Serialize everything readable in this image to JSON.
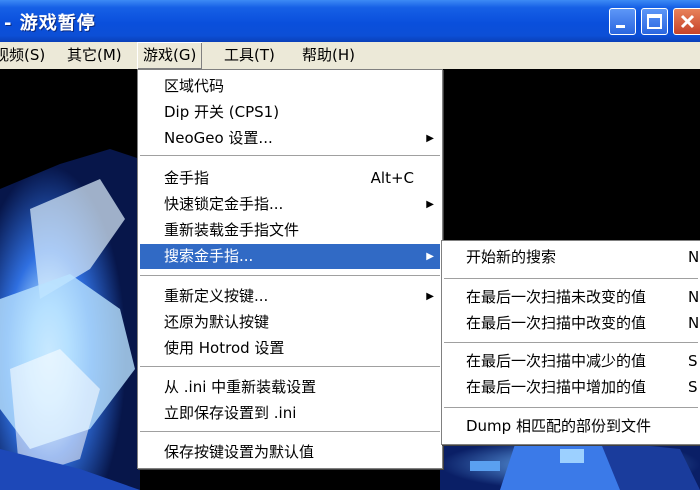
{
  "window": {
    "title": "- 游戏暂停"
  },
  "menubar": [
    {
      "label": "视频(S)"
    },
    {
      "label": "其它(M)"
    },
    {
      "label": "游戏(G)"
    },
    {
      "label": "工具(T)"
    },
    {
      "label": "帮助(H)"
    }
  ],
  "game_menu": {
    "items": [
      {
        "label": "区域代码"
      },
      {
        "label": "Dip 开关 (CPS1)"
      },
      {
        "label": "NeoGeo 设置...",
        "submenu": true
      },
      {
        "label": "金手指",
        "shortcut": "Alt+C"
      },
      {
        "label": "快速锁定金手指...",
        "submenu": true
      },
      {
        "label": "重新装载金手指文件"
      },
      {
        "label": "搜索金手指...",
        "submenu": true,
        "highlighted": true
      },
      {
        "label": "重新定义按键...",
        "submenu": true
      },
      {
        "label": "还原为默认按键"
      },
      {
        "label": "使用 Hotrod 设置"
      },
      {
        "label": "从 .ini 中重新装载设置"
      },
      {
        "label": "立即保存设置到 .ini"
      },
      {
        "label": "保存按键设置为默认值"
      }
    ]
  },
  "search_submenu": {
    "items": [
      {
        "label": "开始新的搜索",
        "shortcut": "N"
      },
      {
        "label": "在最后一次扫描未改变的值",
        "shortcut": "N"
      },
      {
        "label": "在最后一次扫描中改变的值",
        "shortcut": "N"
      },
      {
        "label": "在最后一次扫描中减少的值",
        "shortcut": "S"
      },
      {
        "label": "在最后一次扫描中增加的值",
        "shortcut": "S"
      },
      {
        "label": "Dump 相匹配的部份到文件"
      }
    ]
  },
  "colors": {
    "highlight": "#316ac5",
    "menu_bg": "#ece9d8",
    "title_bar": "#0a4fdc"
  }
}
